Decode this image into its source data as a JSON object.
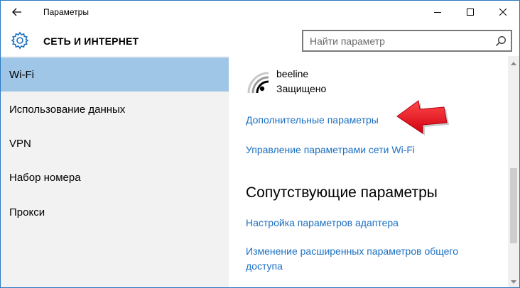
{
  "window": {
    "title": "Параметры"
  },
  "header": {
    "title": "СЕТЬ И ИНТЕРНЕТ",
    "search_placeholder": "Найти параметр"
  },
  "sidebar": {
    "items": [
      {
        "label": "Wi-Fi",
        "active": true
      },
      {
        "label": "Использование данных",
        "active": false
      },
      {
        "label": "VPN",
        "active": false
      },
      {
        "label": "Набор номера",
        "active": false
      },
      {
        "label": "Прокси",
        "active": false
      }
    ]
  },
  "content": {
    "network": {
      "name": "beeline",
      "status": "Защищено"
    },
    "advanced_link": "Дополнительные параметры",
    "manage_link": "Управление параметрами сети Wi-Fi",
    "related_title": "Сопутствующие параметры",
    "adapter_link": "Настройка параметров адаптера",
    "sharing_link": "Изменение расширенных параметров общего доступа"
  },
  "colors": {
    "accent_link": "#1b6fc2",
    "sidebar_active": "#9fc6e6",
    "sidebar_bg": "#f2f2f2",
    "arrow": "#e8141c",
    "window_border": "#2b78c4"
  },
  "icons": {
    "back": "back-arrow-icon",
    "settings": "gear-icon",
    "search": "search-icon",
    "wifi": "wifi-icon",
    "annotation": "red-arrow-icon"
  }
}
